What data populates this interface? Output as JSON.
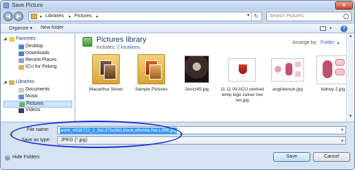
{
  "window": {
    "title": "Save Picture"
  },
  "address": {
    "crumbs": [
      "Libraries",
      "Pictures"
    ],
    "search_placeholder": "Search Pictures"
  },
  "toolbar": {
    "organize": "Organize",
    "new_folder": "New folder"
  },
  "nav": {
    "favorites": "Favorites",
    "desktop": "Desktop",
    "downloads": "Downloads",
    "recent_places": "Recent Places",
    "icu_for_peking": "ICU for Peking",
    "libraries": "Libraries",
    "documents": "Documents",
    "music": "Music",
    "pictures": "Pictures",
    "videos": "Videos"
  },
  "library": {
    "title": "Pictures library",
    "includes_label": "Includes:",
    "locations": "2 locations",
    "arrange_by_label": "Arrange by:",
    "arrange_by_value": "Folder"
  },
  "items": [
    {
      "label": "Macarthur Street"
    },
    {
      "label": "Sample Pictures"
    },
    {
      "label": "2evzz45.jpg"
    },
    {
      "label": "11 11 09 ACU centred temp logo colour low res.jpg"
    },
    {
      "label": "angiotensin.jpg"
    },
    {
      "label": "kidney 2.jpg"
    }
  ],
  "form": {
    "file_name_label": "File name:",
    "file_name_value": "work_4938722_2_flat,375x360,black,offwhite,flat,s,ffffff.jpg",
    "save_as_type_label": "Save as type:",
    "save_as_type_value": "JPEG (*.jpg)"
  },
  "footer": {
    "hide_folders": "Hide Folders",
    "save": "Save",
    "cancel": "Cancel"
  },
  "colors": {
    "annotation_ellipse": "#1d2fd0",
    "selection": "#3399ff"
  }
}
